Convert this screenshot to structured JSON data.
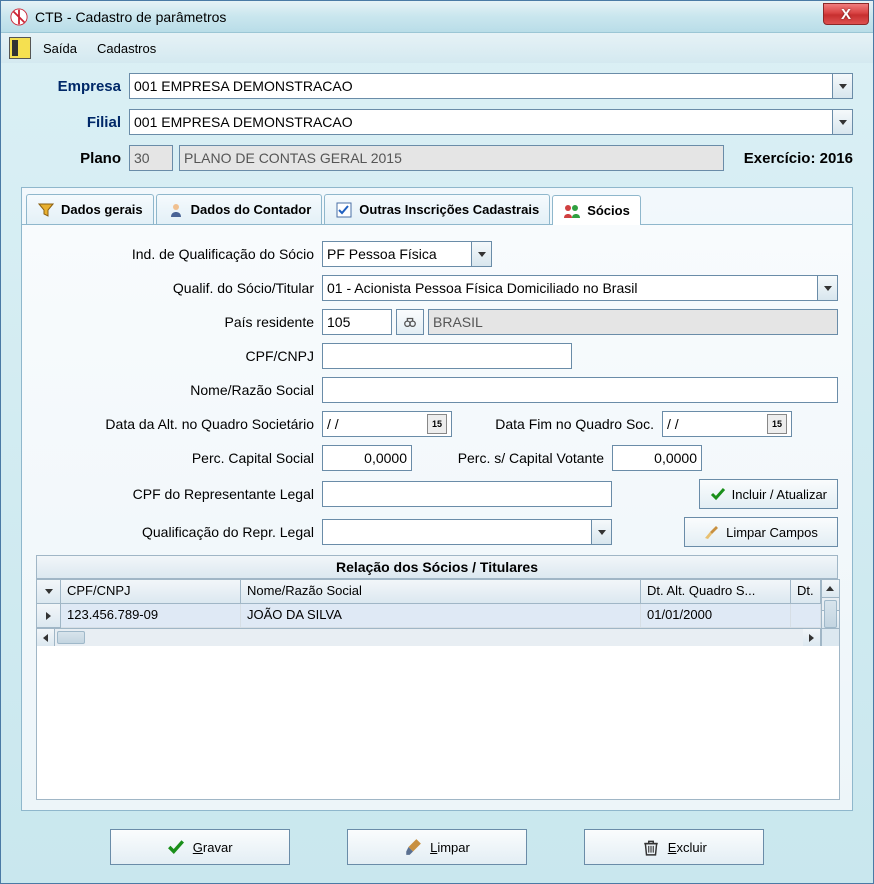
{
  "window": {
    "title": "CTB - Cadastro de parâmetros"
  },
  "menu": {
    "saida": "Saída",
    "cadastros": "Cadastros"
  },
  "header": {
    "empresa_label": "Empresa",
    "empresa_value": "001 EMPRESA DEMONSTRACAO",
    "filial_label": "Filial",
    "filial_value": "001 EMPRESA DEMONSTRACAO",
    "plano_label": "Plano",
    "plano_code": "30",
    "plano_desc": "PLANO DE CONTAS GERAL 2015",
    "exercicio_label": "Exercício: 2016"
  },
  "tabs": {
    "dados_gerais": "Dados gerais",
    "dados_contador": "Dados do Contador",
    "outras_inscricoes": "Outras Inscrições Cadastrais",
    "socios": "Sócios"
  },
  "socios_form": {
    "ind_qualif_label": "Ind. de Qualificação do Sócio",
    "ind_qualif_value": "PF Pessoa Física",
    "qualif_socio_label": "Qualif. do Sócio/Titular",
    "qualif_socio_value": "01 - Acionista Pessoa Física Domiciliado no Brasil",
    "pais_label": "País residente",
    "pais_code": "105",
    "pais_name": "BRASIL",
    "cpf_label": "CPF/CNPJ",
    "cpf_value": "",
    "nome_label": "Nome/Razão Social",
    "nome_value": "",
    "data_alt_label": "Data da Alt. no Quadro Societário",
    "data_alt_value": "  /  /",
    "data_fim_label": "Data Fim no Quadro Soc.",
    "data_fim_value": "  /  /",
    "perc_cap_label": "Perc. Capital Social",
    "perc_cap_value": "0,0000",
    "perc_vot_label": "Perc. s/ Capital Votante",
    "perc_vot_value": "0,0000",
    "cpf_repr_label": "CPF do Representante Legal",
    "cpf_repr_value": "",
    "qualif_repr_label": "Qualificação do Repr. Legal",
    "qualif_repr_value": "",
    "btn_incluir": "Incluir / Atualizar",
    "btn_limpar_campos": "Limpar Campos"
  },
  "grid": {
    "title": "Relação dos Sócios / Titulares",
    "columns": {
      "cpf": "CPF/CNPJ",
      "nome": "Nome/Razão Social",
      "dt_alt": "Dt. Alt. Quadro S...",
      "dt": "Dt."
    },
    "rows": [
      {
        "cpf": "123.456.789-09",
        "nome": "JOÃO DA SILVA",
        "dt_alt": "01/01/2000",
        "dt": ""
      }
    ]
  },
  "footer": {
    "gravar": "Gravar",
    "limpar": "Limpar",
    "excluir": "Excluir"
  }
}
